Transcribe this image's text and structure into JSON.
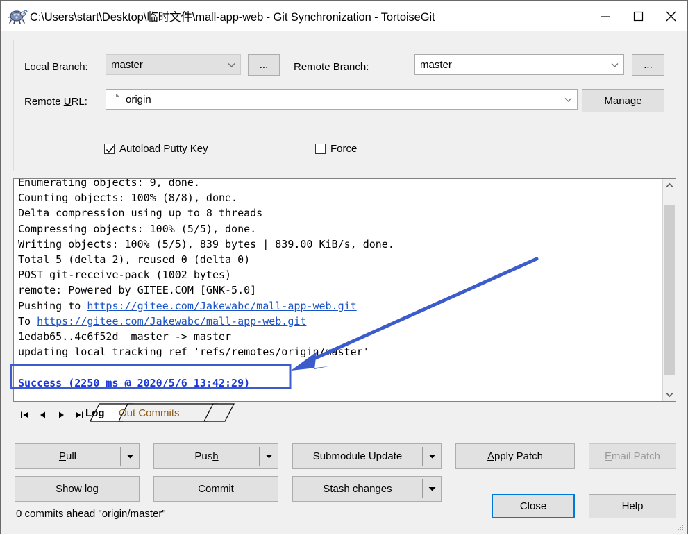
{
  "window": {
    "title": "C:\\Users\\start\\Desktop\\临时文件\\mall-app-web - Git Synchronization - TortoiseGit",
    "app_icon": "tortoise-turtle-icon",
    "controls": {
      "minimize": "minimize-icon",
      "maximize": "maximize-icon",
      "close": "close-icon"
    }
  },
  "form": {
    "local_branch_label": "Local Branch:",
    "local_branch_value": "master",
    "local_branch_browse": "...",
    "remote_branch_label": "Remote Branch:",
    "remote_branch_value": "master",
    "remote_branch_browse": "...",
    "remote_url_label": "Remote URL:",
    "remote_url_value": "origin",
    "manage_label": "Manage",
    "autoload_putty_key_label": "Autoload Putty Key",
    "autoload_putty_key_checked": true,
    "force_label": "Force",
    "force_checked": false
  },
  "log": {
    "lines": [
      {
        "text": "Enumerating objects: 9, done.",
        "style": "plain"
      },
      {
        "text": "Counting objects: 100% (8/8), done.",
        "style": "plain"
      },
      {
        "text": "Delta compression using up to 8 threads",
        "style": "plain"
      },
      {
        "text": "Compressing objects: 100% (5/5), done.",
        "style": "plain"
      },
      {
        "text": "Writing objects: 100% (5/5), 839 bytes | 839.00 KiB/s, done.",
        "style": "plain"
      },
      {
        "text": "Total 5 (delta 2), reused 0 (delta 0)",
        "style": "plain"
      },
      {
        "text": "POST git-receive-pack (1002 bytes)",
        "style": "plain"
      },
      {
        "text": "remote: Powered by GITEE.COM [GNK-5.0]",
        "style": "plain"
      },
      {
        "prefix": "Pushing to ",
        "link": "https://gitee.com/Jakewabc/mall-app-web.git",
        "style": "link"
      },
      {
        "prefix": "To ",
        "link": "https://gitee.com/Jakewabc/mall-app-web.git",
        "style": "link"
      },
      {
        "text": "1edab65..4c6f52d  master -> master",
        "style": "plain"
      },
      {
        "text": "updating local tracking ref 'refs/remotes/origin/master'",
        "style": "plain"
      },
      {
        "text": "",
        "style": "blank"
      },
      {
        "text": "Success (2250 ms @ 2020/5/6 13:42:29)",
        "style": "success"
      }
    ],
    "scrollbar": {
      "up_arrow": "chevron-up-icon",
      "down_arrow": "chevron-down-icon"
    }
  },
  "annotation": {
    "highlight_color": "#3c5ccc",
    "arrow_color": "#3c5ccc"
  },
  "tabs": {
    "nav": {
      "first": "nav-first-icon",
      "prev": "nav-prev-icon",
      "next": "nav-next-icon",
      "last": "nav-last-icon"
    },
    "items": [
      {
        "label": "Log",
        "active": true
      },
      {
        "label": "Out Commits",
        "active": false
      }
    ]
  },
  "buttons": {
    "pull": "Pull",
    "push": "Push",
    "submodule_update": "Submodule Update",
    "apply_patch": "Apply Patch",
    "email_patch": "Email Patch",
    "show_log": "Show log",
    "commit": "Commit",
    "stash_changes": "Stash changes",
    "close": "Close",
    "help": "Help"
  },
  "statusbar": {
    "text": "0 commits ahead \"origin/master\""
  }
}
